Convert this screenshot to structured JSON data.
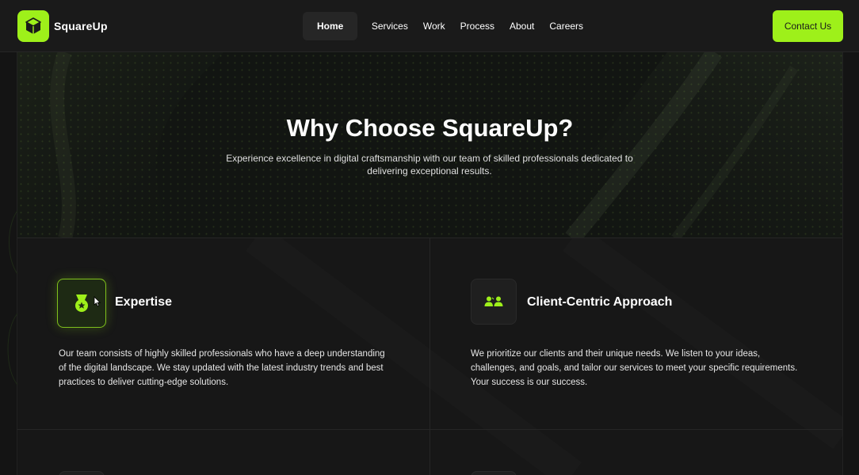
{
  "header": {
    "brand": "SquareUp",
    "nav": [
      {
        "label": "Home",
        "active": true
      },
      {
        "label": "Services",
        "active": false
      },
      {
        "label": "Work",
        "active": false
      },
      {
        "label": "Process",
        "active": false
      },
      {
        "label": "About",
        "active": false
      },
      {
        "label": "Careers",
        "active": false
      }
    ],
    "cta_label": "Contact Us"
  },
  "hero": {
    "title": "Why Choose SquareUp?",
    "subtitle": "Experience excellence in digital craftsmanship with our team of skilled professionals dedicated to delivering exceptional results."
  },
  "features": [
    {
      "icon": "medal-icon",
      "title": "Expertise",
      "description": "Our team consists of highly skilled professionals who have a deep understanding of the digital landscape. We stay updated with the latest industry trends and best practices to deliver cutting-edge solutions."
    },
    {
      "icon": "users-icon",
      "title": "Client-Centric Approach",
      "description": "We prioritize our clients and their unique needs. We listen to your ideas, challenges, and goals, and tailor our services to meet your specific requirements. Your success is our success."
    }
  ],
  "colors": {
    "accent": "#9ef01a",
    "background": "#141414",
    "surface": "#1a1a1a"
  }
}
